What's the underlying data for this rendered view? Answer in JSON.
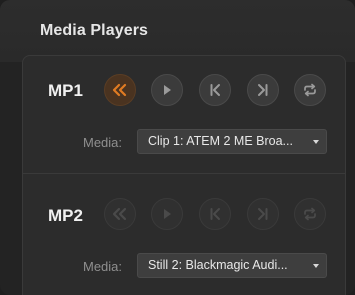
{
  "panel": {
    "title": "Media Players"
  },
  "colors": {
    "accent": "#e07b22",
    "icon_enabled": "#9a9a9a",
    "icon_disabled": "#4a4a4a",
    "background": "#232323"
  },
  "players": [
    {
      "label": "MP1",
      "media_label": "Media:",
      "media_value": "Clip 1: ATEM 2 ME Broa...",
      "controls": [
        {
          "name": "rewind-icon",
          "state": "active"
        },
        {
          "name": "play-icon",
          "state": "enabled"
        },
        {
          "name": "previous-frame-icon",
          "state": "enabled"
        },
        {
          "name": "next-frame-icon",
          "state": "enabled"
        },
        {
          "name": "loop-icon",
          "state": "enabled"
        }
      ]
    },
    {
      "label": "MP2",
      "media_label": "Media:",
      "media_value": "Still 2: Blackmagic Audi...",
      "controls": [
        {
          "name": "rewind-icon",
          "state": "disabled"
        },
        {
          "name": "play-icon",
          "state": "disabled"
        },
        {
          "name": "previous-frame-icon",
          "state": "disabled"
        },
        {
          "name": "next-frame-icon",
          "state": "disabled"
        },
        {
          "name": "loop-icon",
          "state": "disabled"
        }
      ]
    }
  ]
}
